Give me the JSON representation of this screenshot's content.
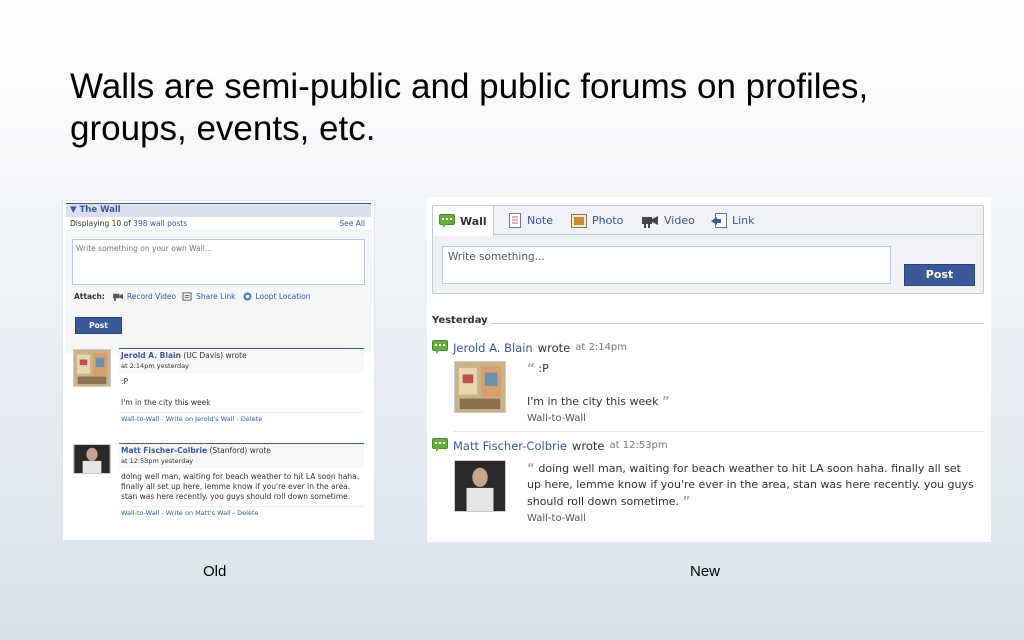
{
  "slide": {
    "title": "Walls are semi-public and public forums on profiles, groups, events, etc.",
    "caption_old": "Old",
    "caption_new": "New"
  },
  "old_wall": {
    "header": "▼ The Wall",
    "displaying_prefix": "Displaying 10 of ",
    "displaying_link": "398 wall posts",
    "see_all": "See All",
    "placeholder": "Write something on your own Wall...",
    "attach_label": "Attach:",
    "attachments": [
      {
        "label": "Record Video",
        "icon": "video-camera-icon"
      },
      {
        "label": "Share Link",
        "icon": "share-link-icon"
      },
      {
        "label": "Loopt Location",
        "icon": "location-icon"
      }
    ],
    "post_button": "Post",
    "posts": [
      {
        "name": "Jerold A. Blain",
        "affiliation": " (UC Davis) wrote",
        "time": "at 2:14pm yesterday",
        "line1": ":P",
        "line2": "I'm in the city this week",
        "links": "Wall-to-Wall - Write on Jerold's Wall - Delete"
      },
      {
        "name": "Matt Fischer-Colbrie",
        "affiliation": " (Stanford) wrote",
        "time": "at 12:53pm yesterday",
        "text": "doing well man, waiting for beach weather to hit LA soon haha. finally all set up here, lemme know if you're ever in the area. stan was here recently. you guys should roll down sometime.",
        "links": "Wall-to-Wall - Write on Matt's Wall - Delete"
      }
    ]
  },
  "new_wall": {
    "tabs": [
      {
        "label": "Wall",
        "icon": "wall-speech-icon"
      },
      {
        "label": "Note",
        "icon": "note-icon"
      },
      {
        "label": "Photo",
        "icon": "photo-icon"
      },
      {
        "label": "Video",
        "icon": "video-camera-icon"
      },
      {
        "label": "Link",
        "icon": "link-icon"
      }
    ],
    "placeholder": "Write something...",
    "post_button": "Post",
    "section": "Yesterday",
    "stories": [
      {
        "name": "Jerold A. Blain",
        "verb": "wrote",
        "time": "at 2:14pm",
        "line1": ":P",
        "line2": "I'm in the city this week",
        "meta": "Wall-to-Wall"
      },
      {
        "name": "Matt Fischer-Colbrie",
        "verb": "wrote",
        "time": "at 12:53pm",
        "text": "doing well man, waiting for beach weather to hit LA soon haha. finally all set up here, lemme know if you're ever in the area, stan was here recently. you guys should roll down sometime.",
        "meta": "Wall-to-Wall"
      }
    ]
  },
  "colors": {
    "facebook_blue": "#3b5998",
    "wall_icon_green": "#6aab3f"
  }
}
